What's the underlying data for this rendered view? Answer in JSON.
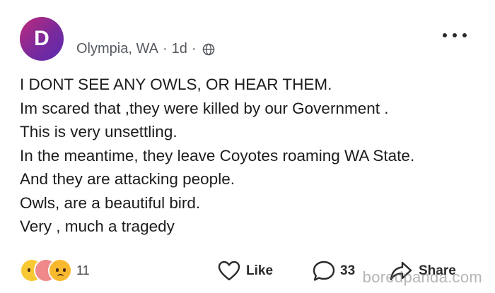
{
  "author": {
    "avatar_letter": "D",
    "avatar_colors": [
      "#c02a7a",
      "#5b2bb0"
    ]
  },
  "meta": {
    "location": "Olympia, WA",
    "separator": "·",
    "time": "1d",
    "visibility_icon": "globe-icon"
  },
  "menu": {
    "icon": "more-options-icon"
  },
  "post": {
    "lines": [
      "I DONT SEE ANY OWLS, OR HEAR THEM.",
      "Im scared that ,they were killed by our Government .",
      "This is very unsettling.",
      "In the meantime, they leave Coyotes roaming WA State.",
      "And they are attacking people.",
      "Owls, are a beautiful bird.",
      "Very , much a tragedy"
    ]
  },
  "reactions": {
    "icons": [
      "haha-emoji-icon",
      "care-emoji-icon",
      "sad-emoji-icon"
    ],
    "count": "11"
  },
  "actions": {
    "like_label": "Like",
    "comment_count": "33",
    "share_label": "Share"
  },
  "watermark": "boredpanda.com"
}
